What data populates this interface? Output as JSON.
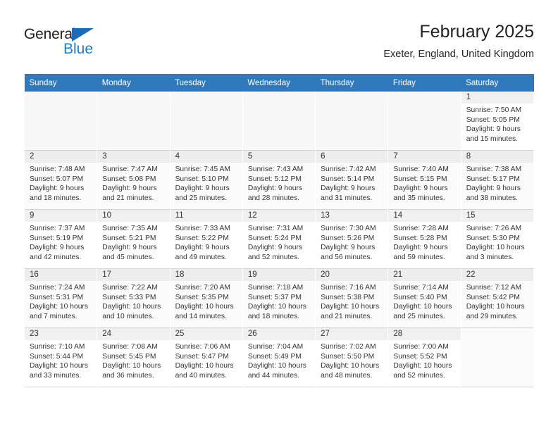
{
  "brand": {
    "name_primary": "General",
    "name_secondary": "Blue",
    "primary_color": "#231f20",
    "secondary_color": "#1b7fd4"
  },
  "header": {
    "title": "February 2025",
    "subtitle": "Exeter, England, United Kingdom"
  },
  "theme": {
    "header_row_color": "#3179bd",
    "daynum_background": "#f0f0f0",
    "grid_line_color": "#d2d2d2"
  },
  "weekday_headers": [
    "Sunday",
    "Monday",
    "Tuesday",
    "Wednesday",
    "Thursday",
    "Friday",
    "Saturday"
  ],
  "weeks": [
    [
      {
        "empty": true
      },
      {
        "empty": true
      },
      {
        "empty": true
      },
      {
        "empty": true
      },
      {
        "empty": true
      },
      {
        "empty": true
      },
      {
        "empty": false,
        "day": "1",
        "sunrise": "Sunrise: 7:50 AM",
        "sunset": "Sunset: 5:05 PM",
        "daylight_line1": "Daylight: 9 hours",
        "daylight_line2": "and 15 minutes."
      }
    ],
    [
      {
        "empty": false,
        "day": "2",
        "sunrise": "Sunrise: 7:48 AM",
        "sunset": "Sunset: 5:07 PM",
        "daylight_line1": "Daylight: 9 hours",
        "daylight_line2": "and 18 minutes."
      },
      {
        "empty": false,
        "day": "3",
        "sunrise": "Sunrise: 7:47 AM",
        "sunset": "Sunset: 5:08 PM",
        "daylight_line1": "Daylight: 9 hours",
        "daylight_line2": "and 21 minutes."
      },
      {
        "empty": false,
        "day": "4",
        "sunrise": "Sunrise: 7:45 AM",
        "sunset": "Sunset: 5:10 PM",
        "daylight_line1": "Daylight: 9 hours",
        "daylight_line2": "and 25 minutes."
      },
      {
        "empty": false,
        "day": "5",
        "sunrise": "Sunrise: 7:43 AM",
        "sunset": "Sunset: 5:12 PM",
        "daylight_line1": "Daylight: 9 hours",
        "daylight_line2": "and 28 minutes."
      },
      {
        "empty": false,
        "day": "6",
        "sunrise": "Sunrise: 7:42 AM",
        "sunset": "Sunset: 5:14 PM",
        "daylight_line1": "Daylight: 9 hours",
        "daylight_line2": "and 31 minutes."
      },
      {
        "empty": false,
        "day": "7",
        "sunrise": "Sunrise: 7:40 AM",
        "sunset": "Sunset: 5:15 PM",
        "daylight_line1": "Daylight: 9 hours",
        "daylight_line2": "and 35 minutes."
      },
      {
        "empty": false,
        "day": "8",
        "sunrise": "Sunrise: 7:38 AM",
        "sunset": "Sunset: 5:17 PM",
        "daylight_line1": "Daylight: 9 hours",
        "daylight_line2": "and 38 minutes."
      }
    ],
    [
      {
        "empty": false,
        "day": "9",
        "sunrise": "Sunrise: 7:37 AM",
        "sunset": "Sunset: 5:19 PM",
        "daylight_line1": "Daylight: 9 hours",
        "daylight_line2": "and 42 minutes."
      },
      {
        "empty": false,
        "day": "10",
        "sunrise": "Sunrise: 7:35 AM",
        "sunset": "Sunset: 5:21 PM",
        "daylight_line1": "Daylight: 9 hours",
        "daylight_line2": "and 45 minutes."
      },
      {
        "empty": false,
        "day": "11",
        "sunrise": "Sunrise: 7:33 AM",
        "sunset": "Sunset: 5:22 PM",
        "daylight_line1": "Daylight: 9 hours",
        "daylight_line2": "and 49 minutes."
      },
      {
        "empty": false,
        "day": "12",
        "sunrise": "Sunrise: 7:31 AM",
        "sunset": "Sunset: 5:24 PM",
        "daylight_line1": "Daylight: 9 hours",
        "daylight_line2": "and 52 minutes."
      },
      {
        "empty": false,
        "day": "13",
        "sunrise": "Sunrise: 7:30 AM",
        "sunset": "Sunset: 5:26 PM",
        "daylight_line1": "Daylight: 9 hours",
        "daylight_line2": "and 56 minutes."
      },
      {
        "empty": false,
        "day": "14",
        "sunrise": "Sunrise: 7:28 AM",
        "sunset": "Sunset: 5:28 PM",
        "daylight_line1": "Daylight: 9 hours",
        "daylight_line2": "and 59 minutes."
      },
      {
        "empty": false,
        "day": "15",
        "sunrise": "Sunrise: 7:26 AM",
        "sunset": "Sunset: 5:30 PM",
        "daylight_line1": "Daylight: 10 hours",
        "daylight_line2": "and 3 minutes."
      }
    ],
    [
      {
        "empty": false,
        "day": "16",
        "sunrise": "Sunrise: 7:24 AM",
        "sunset": "Sunset: 5:31 PM",
        "daylight_line1": "Daylight: 10 hours",
        "daylight_line2": "and 7 minutes."
      },
      {
        "empty": false,
        "day": "17",
        "sunrise": "Sunrise: 7:22 AM",
        "sunset": "Sunset: 5:33 PM",
        "daylight_line1": "Daylight: 10 hours",
        "daylight_line2": "and 10 minutes."
      },
      {
        "empty": false,
        "day": "18",
        "sunrise": "Sunrise: 7:20 AM",
        "sunset": "Sunset: 5:35 PM",
        "daylight_line1": "Daylight: 10 hours",
        "daylight_line2": "and 14 minutes."
      },
      {
        "empty": false,
        "day": "19",
        "sunrise": "Sunrise: 7:18 AM",
        "sunset": "Sunset: 5:37 PM",
        "daylight_line1": "Daylight: 10 hours",
        "daylight_line2": "and 18 minutes."
      },
      {
        "empty": false,
        "day": "20",
        "sunrise": "Sunrise: 7:16 AM",
        "sunset": "Sunset: 5:38 PM",
        "daylight_line1": "Daylight: 10 hours",
        "daylight_line2": "and 21 minutes."
      },
      {
        "empty": false,
        "day": "21",
        "sunrise": "Sunrise: 7:14 AM",
        "sunset": "Sunset: 5:40 PM",
        "daylight_line1": "Daylight: 10 hours",
        "daylight_line2": "and 25 minutes."
      },
      {
        "empty": false,
        "day": "22",
        "sunrise": "Sunrise: 7:12 AM",
        "sunset": "Sunset: 5:42 PM",
        "daylight_line1": "Daylight: 10 hours",
        "daylight_line2": "and 29 minutes."
      }
    ],
    [
      {
        "empty": false,
        "day": "23",
        "sunrise": "Sunrise: 7:10 AM",
        "sunset": "Sunset: 5:44 PM",
        "daylight_line1": "Daylight: 10 hours",
        "daylight_line2": "and 33 minutes."
      },
      {
        "empty": false,
        "day": "24",
        "sunrise": "Sunrise: 7:08 AM",
        "sunset": "Sunset: 5:45 PM",
        "daylight_line1": "Daylight: 10 hours",
        "daylight_line2": "and 36 minutes."
      },
      {
        "empty": false,
        "day": "25",
        "sunrise": "Sunrise: 7:06 AM",
        "sunset": "Sunset: 5:47 PM",
        "daylight_line1": "Daylight: 10 hours",
        "daylight_line2": "and 40 minutes."
      },
      {
        "empty": false,
        "day": "26",
        "sunrise": "Sunrise: 7:04 AM",
        "sunset": "Sunset: 5:49 PM",
        "daylight_line1": "Daylight: 10 hours",
        "daylight_line2": "and 44 minutes."
      },
      {
        "empty": false,
        "day": "27",
        "sunrise": "Sunrise: 7:02 AM",
        "sunset": "Sunset: 5:50 PM",
        "daylight_line1": "Daylight: 10 hours",
        "daylight_line2": "and 48 minutes."
      },
      {
        "empty": false,
        "day": "28",
        "sunrise": "Sunrise: 7:00 AM",
        "sunset": "Sunset: 5:52 PM",
        "daylight_line1": "Daylight: 10 hours",
        "daylight_line2": "and 52 minutes."
      },
      {
        "empty": true
      }
    ]
  ]
}
